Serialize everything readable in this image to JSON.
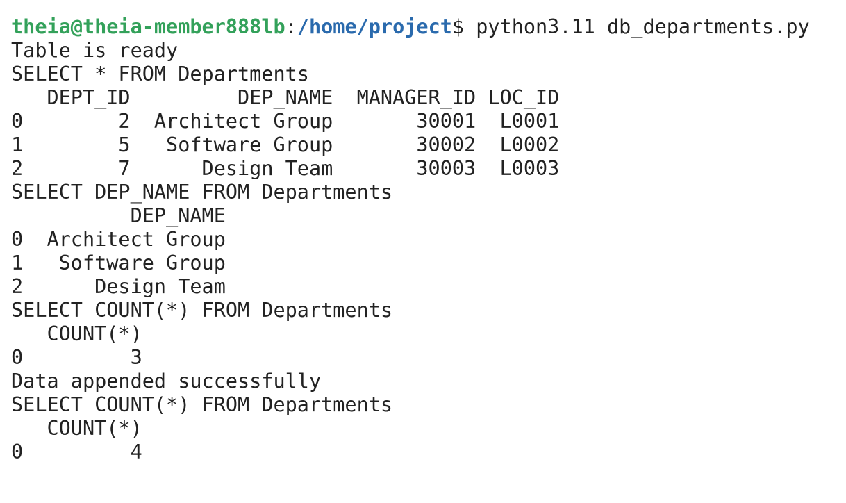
{
  "prompt": {
    "user_host": "theia@theia-member888lb",
    "sep": ":",
    "path": "/home/project",
    "dollar": "$",
    "command": " python3.11 db_departments.py"
  },
  "colors": {
    "prompt_user": "#33a15a",
    "prompt_path": "#2a6aad",
    "text": "#222222",
    "background": "#ffffff"
  },
  "output": [
    "Table is ready",
    "SELECT * FROM Departments",
    "   DEPT_ID         DEP_NAME  MANAGER_ID LOC_ID",
    "0        2  Architect Group       30001  L0001",
    "1        5   Software Group       30002  L0002",
    "2        7      Design Team       30003  L0003",
    "SELECT DEP_NAME FROM Departments",
    "          DEP_NAME",
    "0  Architect Group",
    "1   Software Group",
    "2      Design Team",
    "SELECT COUNT(*) FROM Departments",
    "   COUNT(*)",
    "0         3",
    "Data appended successfully",
    "SELECT COUNT(*) FROM Departments",
    "   COUNT(*)",
    "0         4"
  ]
}
